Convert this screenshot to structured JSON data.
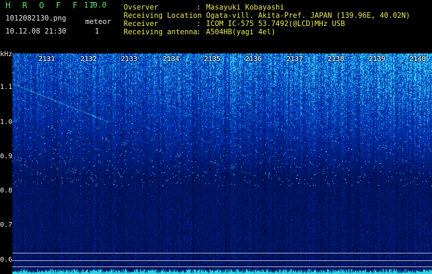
{
  "app": {
    "name": "H R O F F T",
    "version": "1.0.0"
  },
  "file": {
    "name": "1012082130.png",
    "datetime": "10.12.08 21:30"
  },
  "meteor": {
    "label": "meteor",
    "count": "1"
  },
  "info": [
    {
      "label": "Ovserver",
      "value": "Masayuki Kobayashi"
    },
    {
      "label": "Receiving Location",
      "value": "Ogata-vill. Akita-Pref. JAPAN (139.96E, 40.02N)"
    },
    {
      "label": "Receiver",
      "value": "ICOM IC-575 53.7492(@LCD)MHz USB"
    },
    {
      "label": "Receiving antenna",
      "value": "A504HB(yagi 4el)"
    }
  ],
  "spectrogram": {
    "unit": "kHz",
    "y_ticks": [
      "1.1",
      "1.0",
      "0.9",
      "0.8",
      "0.7",
      "0.6"
    ],
    "time_ticks": [
      "2131",
      "2132",
      "2133",
      "2134",
      "2135",
      "2136",
      "2137",
      "2138",
      "2139",
      "2140"
    ],
    "palette": {
      "background": "#000814",
      "low": "#0a1a6a",
      "mid": "#1a48d0",
      "high": "#38d8e8",
      "line": "#b9c3d6"
    }
  }
}
